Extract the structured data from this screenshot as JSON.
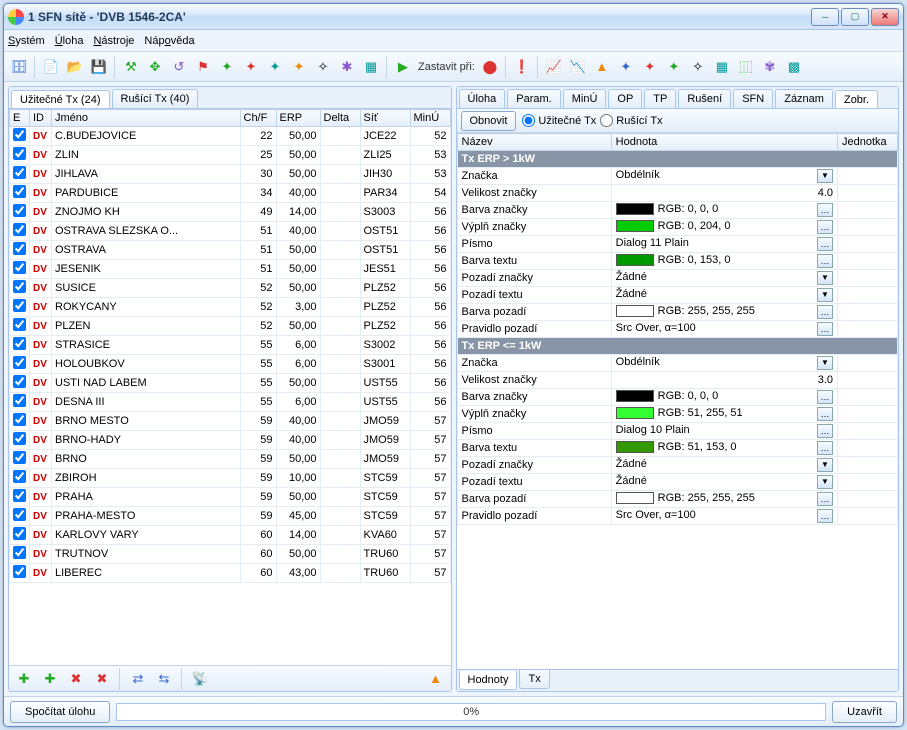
{
  "window": {
    "title": "1 SFN sítě - 'DVB 1546-2CA'"
  },
  "menu": {
    "system": "Systém",
    "task": "Úloha",
    "tools": "Nástroje",
    "help": "Nápověda"
  },
  "toolbar": {
    "stop_at": "Zastavit při:"
  },
  "left": {
    "tab_useful": "Užitečné Tx (24)",
    "tab_interfering": "Rušící Tx (40)",
    "cols": {
      "e": "E",
      "id": "ID",
      "name": "Jméno",
      "chf": "Ch/F",
      "erp": "ERP",
      "delta": "Delta",
      "net": "Síť",
      "minu": "MinÚ"
    },
    "rows": [
      {
        "name": "C.BUDEJOVICE",
        "chf": 22,
        "erp": "50,00",
        "net": "JCE22",
        "minu": 52
      },
      {
        "name": "ZLIN",
        "chf": 25,
        "erp": "50,00",
        "net": "ZLI25",
        "minu": 53
      },
      {
        "name": "JIHLAVA",
        "chf": 30,
        "erp": "50,00",
        "net": "JIH30",
        "minu": 53
      },
      {
        "name": "PARDUBICE",
        "chf": 34,
        "erp": "40,00",
        "net": "PAR34",
        "minu": 54
      },
      {
        "name": "ZNOJMO KH",
        "chf": 49,
        "erp": "14,00",
        "net": "S3003",
        "minu": 56
      },
      {
        "name": "OSTRAVA SLEZSKA O...",
        "chf": 51,
        "erp": "40,00",
        "net": "OST51",
        "minu": 56
      },
      {
        "name": "OSTRAVA",
        "chf": 51,
        "erp": "50,00",
        "net": "OST51",
        "minu": 56
      },
      {
        "name": "JESENIK",
        "chf": 51,
        "erp": "50,00",
        "net": "JES51",
        "minu": 56
      },
      {
        "name": "SUSICE",
        "chf": 52,
        "erp": "50,00",
        "net": "PLZ52",
        "minu": 56
      },
      {
        "name": "ROKYCANY",
        "chf": 52,
        "erp": "3,00",
        "net": "PLZ52",
        "minu": 56
      },
      {
        "name": "PLZEN",
        "chf": 52,
        "erp": "50,00",
        "net": "PLZ52",
        "minu": 56
      },
      {
        "name": "STRASICE",
        "chf": 55,
        "erp": "6,00",
        "net": "S3002",
        "minu": 56
      },
      {
        "name": "HOLOUBKOV",
        "chf": 55,
        "erp": "6,00",
        "net": "S3001",
        "minu": 56
      },
      {
        "name": "USTI NAD LABEM",
        "chf": 55,
        "erp": "50,00",
        "net": "UST55",
        "minu": 56
      },
      {
        "name": "DESNA III",
        "chf": 55,
        "erp": "6,00",
        "net": "UST55",
        "minu": 56
      },
      {
        "name": "BRNO MESTO",
        "chf": 59,
        "erp": "40,00",
        "net": "JMO59",
        "minu": 57
      },
      {
        "name": "BRNO-HADY",
        "chf": 59,
        "erp": "40,00",
        "net": "JMO59",
        "minu": 57
      },
      {
        "name": "BRNO",
        "chf": 59,
        "erp": "50,00",
        "net": "JMO59",
        "minu": 57
      },
      {
        "name": "ZBIROH",
        "chf": 59,
        "erp": "10,00",
        "net": "STC59",
        "minu": 57
      },
      {
        "name": "PRAHA",
        "chf": 59,
        "erp": "50,00",
        "net": "STC59",
        "minu": 57
      },
      {
        "name": "PRAHA-MESTO",
        "chf": 59,
        "erp": "45,00",
        "net": "STC59",
        "minu": 57
      },
      {
        "name": "KARLOVY VARY",
        "chf": 60,
        "erp": "14,00",
        "net": "KVA60",
        "minu": 57
      },
      {
        "name": "TRUTNOV",
        "chf": 60,
        "erp": "50,00",
        "net": "TRU60",
        "minu": 57
      },
      {
        "name": "LIBEREC",
        "chf": 60,
        "erp": "43,00",
        "net": "TRU60",
        "minu": 57
      }
    ]
  },
  "right": {
    "tabs": [
      "Úloha",
      "Param.",
      "MinÚ",
      "OP",
      "TP",
      "Rušení",
      "SFN",
      "Záznam",
      "Zobr."
    ],
    "active_tab": 8,
    "refresh": "Obnovit",
    "radio_useful": "Užitečné Tx",
    "radio_interfering": "Rušící Tx",
    "cols": {
      "name": "Název",
      "value": "Hodnota",
      "unit": "Jednotka"
    },
    "section_gt": "Tx ERP > 1kW",
    "section_le": "Tx ERP <= 1kW",
    "props_gt": {
      "marker": "Značka",
      "marker_v": "Obdélník",
      "marker_size": "Velikost značky",
      "marker_size_v": "4.0",
      "marker_color": "Barva značky",
      "marker_color_v": "RGB:    0,    0,    0",
      "marker_color_sw": "#000000",
      "marker_fill": "Výplň značky",
      "marker_fill_v": "RGB:    0, 204,    0",
      "marker_fill_sw": "#00cc00",
      "font": "Písmo",
      "font_v": "Dialog 11 Plain",
      "text_color": "Barva textu",
      "text_color_v": "RGB:    0, 153,    0",
      "text_color_sw": "#009900",
      "marker_bg": "Pozadí značky",
      "marker_bg_v": "Žádné",
      "text_bg": "Pozadí textu",
      "text_bg_v": "Žádné",
      "bg_color": "Barva pozadí",
      "bg_color_v": "RGB: 255, 255, 255",
      "bg_color_sw": "#ffffff",
      "bg_rule": "Pravidlo pozadí",
      "bg_rule_v": "Src Over, α=100"
    },
    "props_le": {
      "marker": "Značka",
      "marker_v": "Obdélník",
      "marker_size": "Velikost značky",
      "marker_size_v": "3.0",
      "marker_color": "Barva značky",
      "marker_color_v": "RGB:    0,    0,    0",
      "marker_color_sw": "#000000",
      "marker_fill": "Výplň značky",
      "marker_fill_v": "RGB:  51, 255,  51",
      "marker_fill_sw": "#33ff33",
      "font": "Písmo",
      "font_v": "Dialog 10 Plain",
      "text_color": "Barva textu",
      "text_color_v": "RGB:  51, 153,    0",
      "text_color_sw": "#339900",
      "marker_bg": "Pozadí značky",
      "marker_bg_v": "Žádné",
      "text_bg": "Pozadí textu",
      "text_bg_v": "Žádné",
      "bg_color": "Barva pozadí",
      "bg_color_v": "RGB: 255, 255, 255",
      "bg_color_sw": "#ffffff",
      "bg_rule": "Pravidlo pozadí",
      "bg_rule_v": "Src Over, α=100"
    },
    "bottom_tabs": {
      "values": "Hodnoty",
      "tx": "Tx"
    }
  },
  "footer": {
    "compute": "Spočítat úlohu",
    "progress": "0%",
    "close": "Uzavřít"
  }
}
